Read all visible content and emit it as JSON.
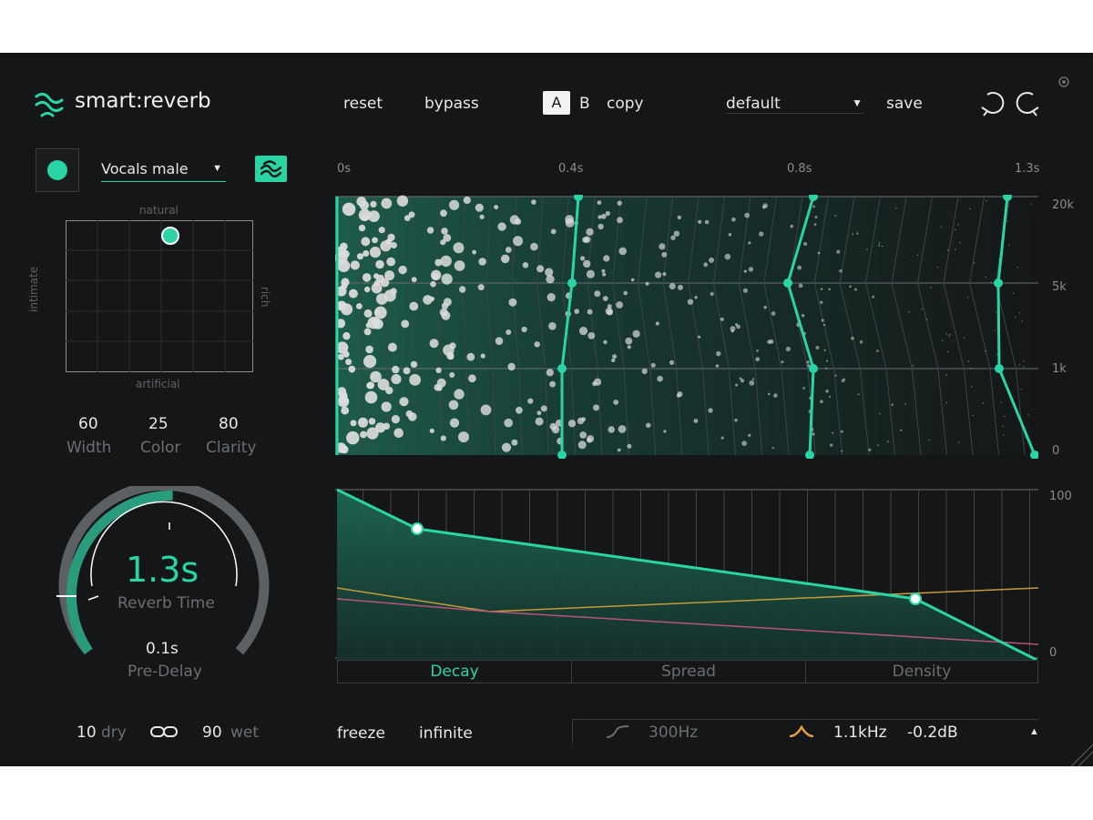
{
  "brand": {
    "name": "smart:reverb"
  },
  "toolbar": {
    "reset": "reset",
    "bypass": "bypass",
    "ab_a": "A",
    "ab_b": "B",
    "copy": "copy",
    "preset": "default",
    "save": "save"
  },
  "profile": {
    "selected": "Vocals male"
  },
  "xy_pad": {
    "top": "natural",
    "bottom": "artificial",
    "left": "intimate",
    "right": "rich"
  },
  "params": [
    {
      "value": "60",
      "label": "Width"
    },
    {
      "value": "25",
      "label": "Color"
    },
    {
      "value": "80",
      "label": "Clarity"
    }
  ],
  "reverb_knob": {
    "value": "1.3s",
    "label": "Reverb Time",
    "predelay_value": "0.1s",
    "predelay_label": "Pre-Delay"
  },
  "mix": {
    "dry_value": "10",
    "dry_label": "dry",
    "wet_value": "90",
    "wet_label": "wet"
  },
  "spectrogram": {
    "time_ticks": [
      "0s",
      "0.4s",
      "0.8s",
      "1.3s"
    ],
    "freq_ticks": [
      "20k",
      "5k",
      "1k",
      "0"
    ]
  },
  "envelope": {
    "y_ticks": [
      "100",
      "0"
    ],
    "tabs": [
      "Decay",
      "Spread",
      "Density"
    ],
    "active_tab": "Decay"
  },
  "bottom": {
    "freeze": "freeze",
    "infinite": "infinite",
    "lowcut": "300Hz",
    "bell_freq": "1.1kHz",
    "bell_gain": "-0.2dB"
  },
  "colors": {
    "accent": "#2ad4a4",
    "background": "#151617",
    "orange": "#e8a13a",
    "pink": "#c0507a"
  }
}
